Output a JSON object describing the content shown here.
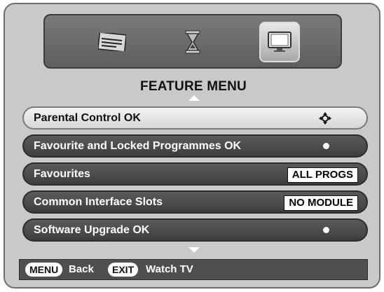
{
  "title": "FEATURE MENU",
  "top_icons": [
    {
      "name": "channel-list-icon",
      "selected": false
    },
    {
      "name": "hourglass-icon",
      "selected": false
    },
    {
      "name": "tv-screen-icon",
      "selected": true
    }
  ],
  "rows": [
    {
      "label": "Parental Control OK",
      "control": "nav-arrows-icon",
      "selected": true
    },
    {
      "label": "Favourite and Locked Programmes OK",
      "control": "dot-icon",
      "selected": false
    },
    {
      "label": "Favourites",
      "value": "ALL PROGS",
      "selected": false
    },
    {
      "label": "Common Interface Slots",
      "value": "NO MODULE",
      "selected": false
    },
    {
      "label": "Software Upgrade OK",
      "control": "dot-icon",
      "selected": false
    }
  ],
  "footer": {
    "menu_key": "MENU",
    "menu_label": "Back",
    "exit_key": "EXIT",
    "exit_label": "Watch TV"
  },
  "colors": {
    "panel": "#c9c9c9",
    "row_dark": "#4a4a4a",
    "row_selected": "#e8e8e8",
    "footer": "#4f4f4f"
  }
}
